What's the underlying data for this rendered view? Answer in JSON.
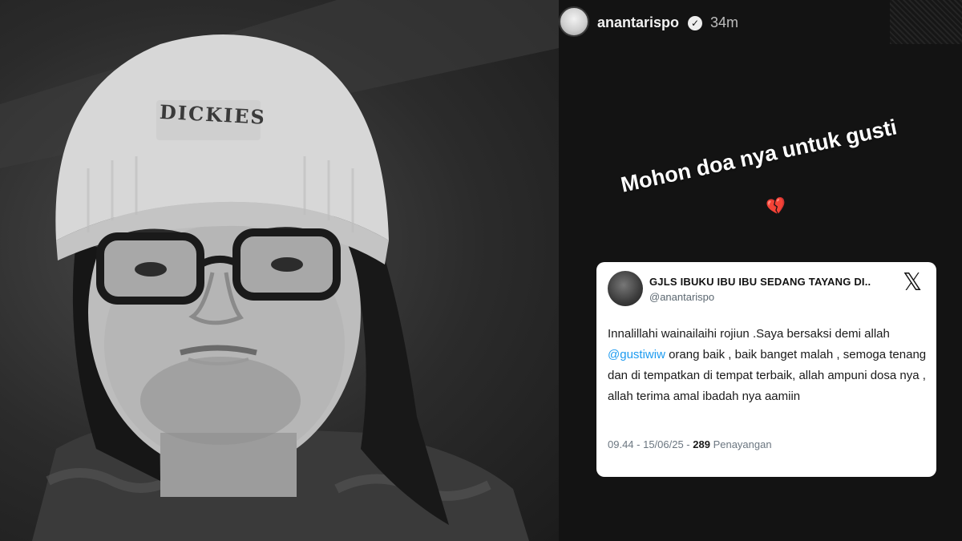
{
  "story": {
    "username": "anantarispo",
    "verified_icon": "✓",
    "time_ago": "34m",
    "caption": "Mohon doa nya untuk gusti",
    "heart_icon": "broken-heart-icon",
    "heart_glyph": "💔"
  },
  "photo": {
    "hat_brand": "DICKIES"
  },
  "tweet": {
    "display_name": "GJLS IBUKU IBU IBU SEDANG TAYANG DI..",
    "handle": "@anantarispo",
    "x_logo": "𝕏",
    "body_before": "Innalillahi wainailaihi rojiun .Saya bersaksi demi allah ",
    "mention": "@gustiwiw",
    "body_after": " orang baik , baik banget malah , semoga tenang dan di tempatkan di tempat terbaik, allah ampuni dosa nya , allah terima amal ibadah nya aamiin",
    "timestamp": "09.44 - 15/06/25 - ",
    "views_count": "289",
    "views_label": " Penayangan"
  },
  "colors": {
    "background": "#131313",
    "mention": "#1d9bf0",
    "heart": "#d8313f"
  }
}
